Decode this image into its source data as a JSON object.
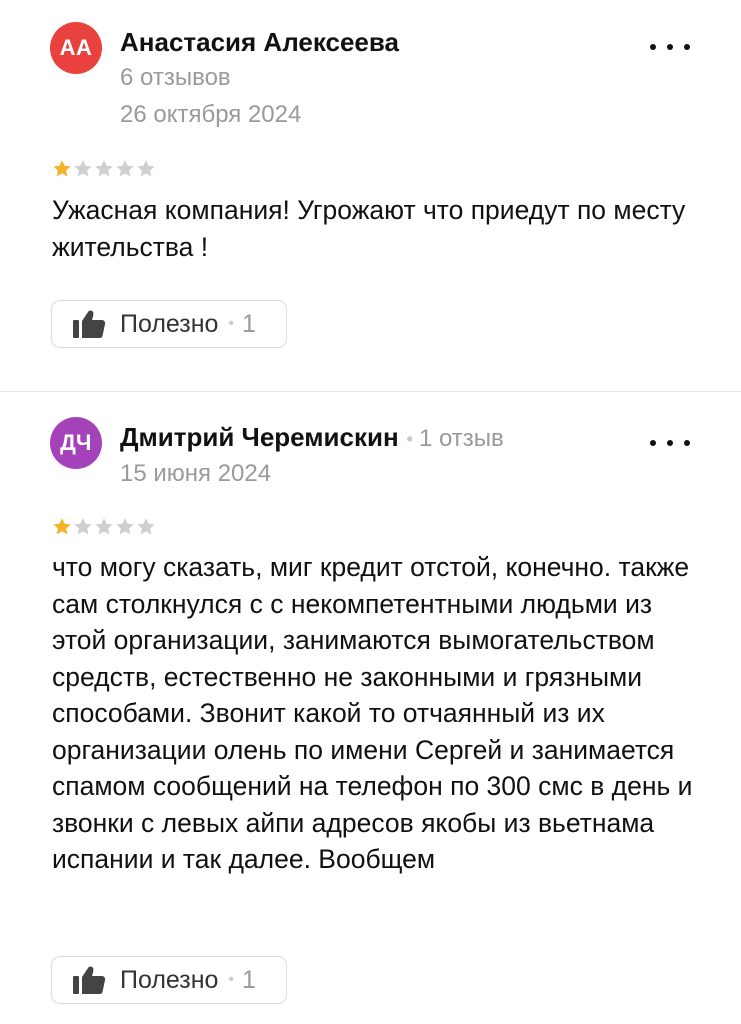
{
  "reviews": [
    {
      "avatar_initials": "АА",
      "avatar_color": "#e8413e",
      "author": "Анастасия Алексеева",
      "review_count": "6 отзывов",
      "date": "26 октября 2024",
      "rating": 1,
      "text": "Ужасная компания! Угрожают что приедут по месту жительства !",
      "useful_label": "Полезно",
      "useful_count": "1"
    },
    {
      "avatar_initials": "ДЧ",
      "avatar_color": "#a442ba",
      "author": "Дмитрий Черемискин",
      "review_count": "1 отзыв",
      "date": "15 июня 2024",
      "rating": 1,
      "text": "что могу сказать, миг кредит отстой, конечно. также сам столкнулся с с некомпетентными людьми из этой организации, занимаются вымогательством средств, естественно не законными и грязными способами. Звонит какой то отчаянный из их организации олень по имени Сергей и занимается спамом сообщений на телефон по 300 смс в день и звонки с левых айпи адресов якобы из вьетнама испании и так далее. Вообщем",
      "useful_label": "Полезно",
      "useful_count": "1"
    }
  ],
  "colors": {
    "star_filled": "#f5b32b",
    "star_empty": "#cfcfcf",
    "muted_text": "#9a9a9a"
  },
  "icons": {
    "more": "more-dots-icon",
    "useful": "thumbs-up-icon",
    "rating": "star-icon"
  }
}
